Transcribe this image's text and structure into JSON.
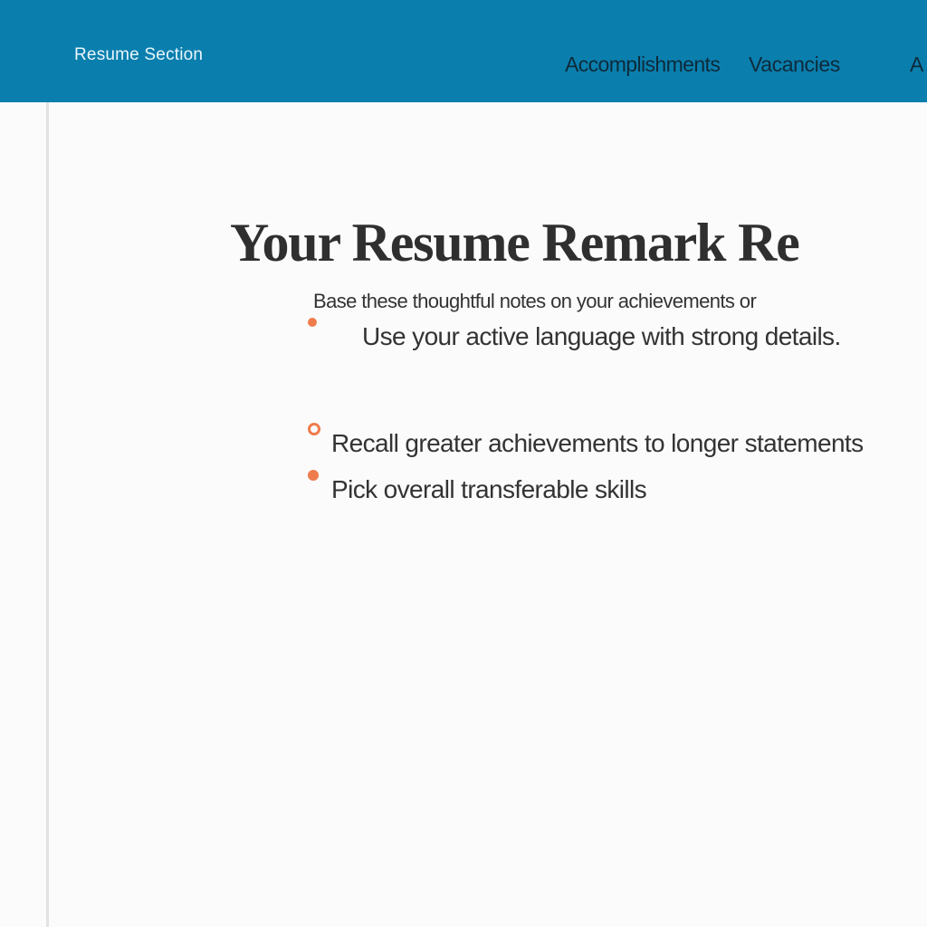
{
  "header": {
    "brand": "Resume Section",
    "nav": [
      "Accomplishments",
      "Vacancies",
      "A"
    ]
  },
  "main": {
    "headline": "Your Resume Remark Re",
    "intro": "Base these thoughtful notes on your achievements or",
    "bullets": [
      {
        "text": "Use your active language with strong details."
      },
      {
        "text": "Recall greater achievements to longer statements"
      },
      {
        "text": "Pick overall transferable skills"
      }
    ]
  },
  "colors": {
    "header_bg": "#0a7fae",
    "accent_bullet": "#ef7c4c"
  },
  "icons": {
    "bullet": "orange-dot-icon"
  }
}
